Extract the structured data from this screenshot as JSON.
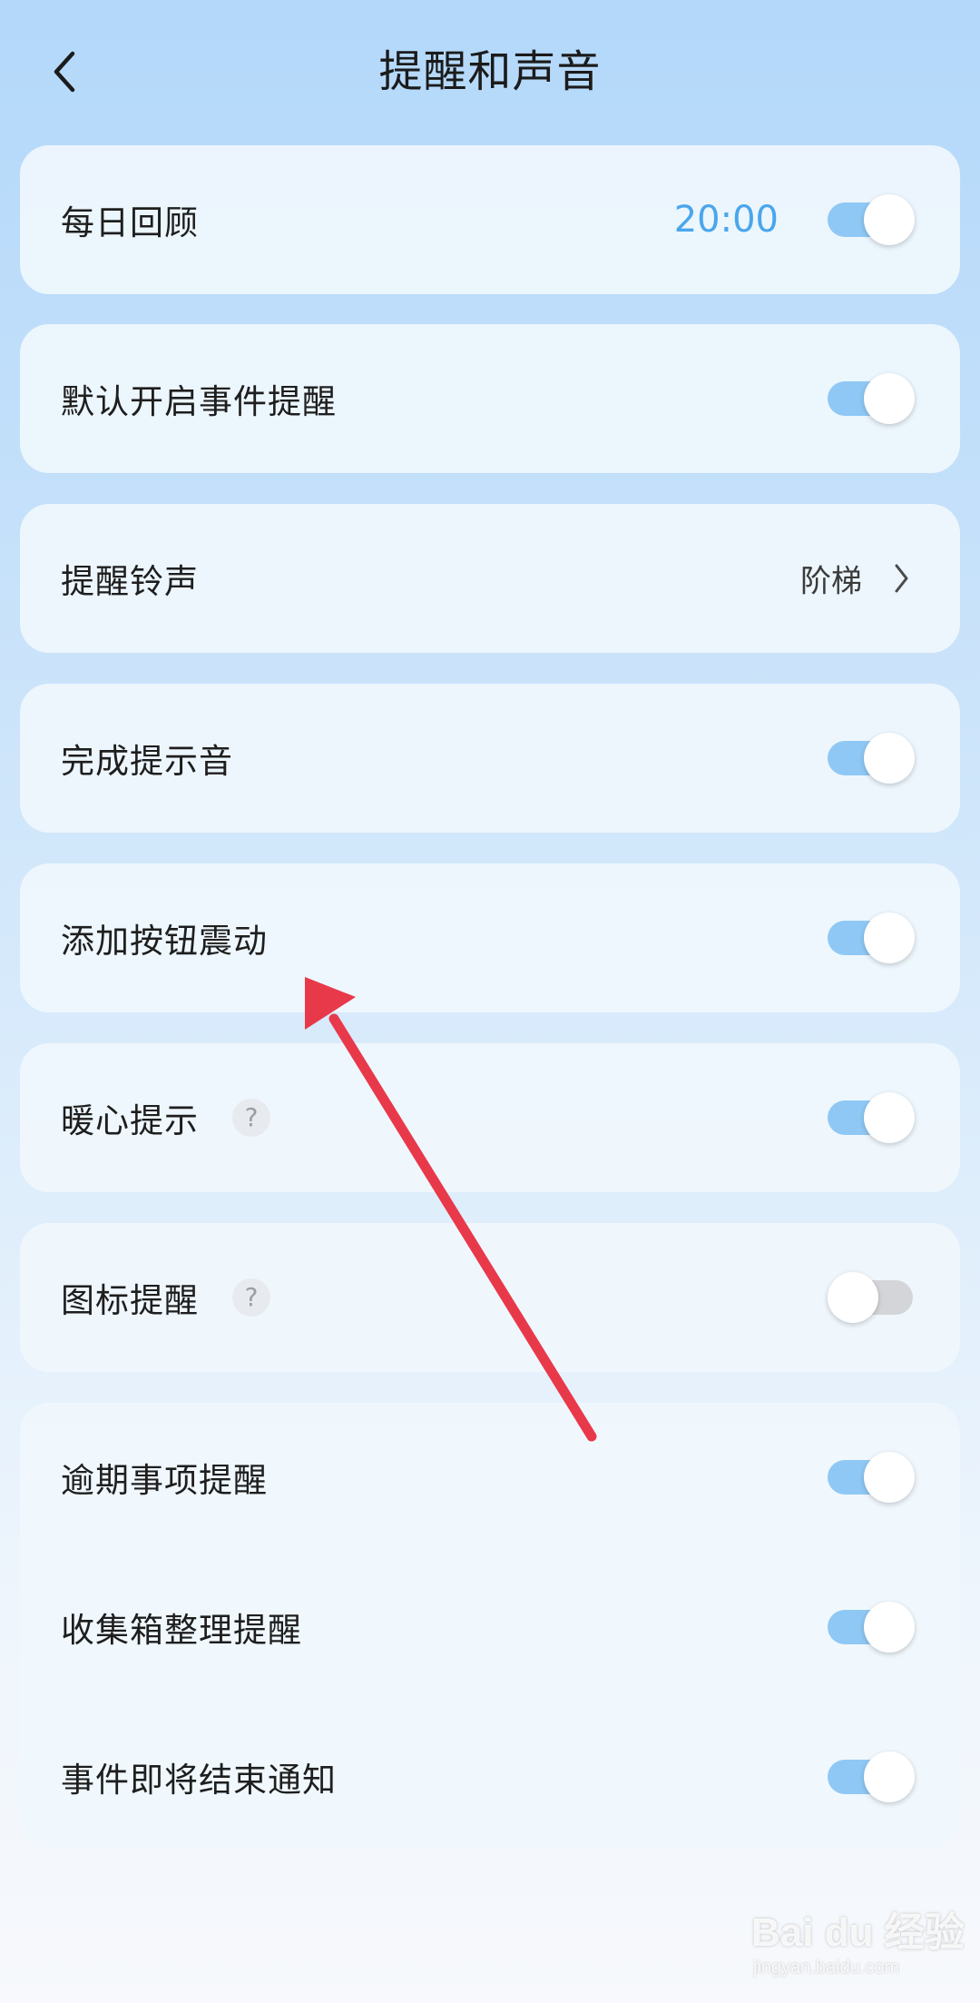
{
  "header": {
    "title": "提醒和声音",
    "back_icon": "chevron-left-icon"
  },
  "settings": {
    "daily_review": {
      "label": "每日回顾",
      "time": "20:00",
      "enabled": true
    },
    "default_event_reminder": {
      "label": "默认开启事件提醒",
      "enabled": true
    },
    "reminder_ringtone": {
      "label": "提醒铃声",
      "value": "阶梯"
    },
    "completion_sound": {
      "label": "完成提示音",
      "enabled": true
    },
    "add_button_vibration": {
      "label": "添加按钮震动",
      "enabled": true
    },
    "warm_tips": {
      "label": "暖心提示",
      "help": "?",
      "enabled": true
    },
    "icon_reminder": {
      "label": "图标提醒",
      "help": "?",
      "enabled": false
    },
    "overdue_reminder": {
      "label": "逾期事项提醒",
      "enabled": true
    },
    "inbox_reminder": {
      "label": "收集箱整理提醒",
      "enabled": true
    },
    "event_ending_notice": {
      "label": "事件即将结束通知",
      "enabled": true
    }
  },
  "colors": {
    "accent": "#4aa6ec",
    "toggle_on": "#8fc8f5",
    "toggle_off": "#d3d5d8",
    "annotation_arrow": "#e8394a"
  },
  "watermark": {
    "brand": "Bai du 经验",
    "url": "jingyan.baidu.com"
  }
}
